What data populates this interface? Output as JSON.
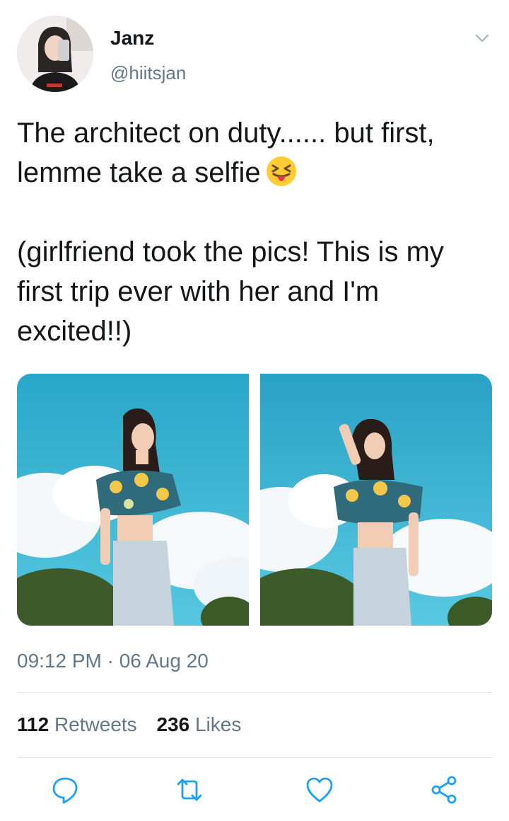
{
  "user": {
    "name": "Janz",
    "handle": "@hiitsjan"
  },
  "tweet": {
    "text": "The architect on duty...... but first,\nlemme take a selfie",
    "text2": "(girlfriend took the pics! This is my first trip ever with her and I'm excited!!)",
    "emoji": "squinting-face-with-tongue"
  },
  "meta": {
    "timestamp": "09:12 PM · 06 Aug 20"
  },
  "stats": {
    "retweets_count": "112",
    "retweets_label": "Retweets",
    "likes_count": "236",
    "likes_label": "Likes"
  },
  "icons": {
    "more": "chevron-down-icon",
    "reply": "reply-icon",
    "retweet": "retweet-icon",
    "like": "like-icon",
    "share": "share-icon"
  },
  "colors": {
    "text_primary": "#14171a",
    "text_secondary": "#657786",
    "icon": "#1da1f2",
    "divider": "#e1e8ed"
  }
}
